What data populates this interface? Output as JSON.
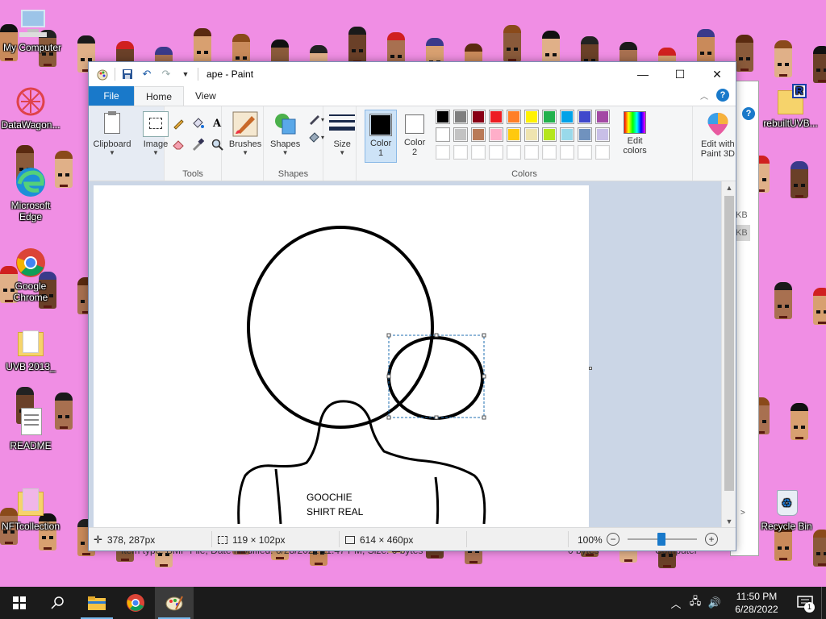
{
  "window": {
    "title": "ape - Paint",
    "minimize_glyph": "—",
    "maximize_glyph": "☐",
    "close_glyph": "✕"
  },
  "tabs": [
    {
      "label": "File"
    },
    {
      "label": "Home"
    },
    {
      "label": "View"
    }
  ],
  "help_glyph": "?",
  "ribbon": {
    "clipboard_label": "Clipboard",
    "image_label": "Image",
    "tools_group": "Tools",
    "brushes_label": "Brushes",
    "shapes_label": "Shapes",
    "shapes_group": "Shapes",
    "size_label": "Size",
    "color1_label_line1": "Color",
    "color1_label_line2": "1",
    "color2_label_line1": "Color",
    "color2_label_line2": "2",
    "edit_colors_line1": "Edit",
    "edit_colors_line2": "colors",
    "edit_paint3d_line1": "Edit with",
    "edit_paint3d_line2": "Paint 3D",
    "colors_group": "Colors",
    "text_tool_glyph": "A"
  },
  "colors": {
    "color1": "#000000",
    "color2": "#ffffff",
    "palette_row1": [
      "#000000",
      "#7f7f7f",
      "#880015",
      "#ed1c24",
      "#ff7f27",
      "#fff200",
      "#22b14c",
      "#00a2e8",
      "#3f48cc",
      "#a349a4"
    ],
    "palette_row2": [
      "#ffffff",
      "#c3c3c3",
      "#b97a57",
      "#ffaec9",
      "#ffc90e",
      "#efe4b0",
      "#b5e61d",
      "#99d9ea",
      "#7092be",
      "#c8bfe7"
    ],
    "palette_row3": [
      "#ffffff",
      "#ffffff",
      "#ffffff",
      "#ffffff",
      "#ffffff",
      "#ffffff",
      "#ffffff",
      "#ffffff",
      "#ffffff",
      "#ffffff"
    ]
  },
  "canvas": {
    "text_line1": "GOOCHIE",
    "text_line2": "SHIRT REAL"
  },
  "status": {
    "cursor_pos": "378, 287px",
    "selection_size": "119 × 102px",
    "image_size": "614 × 460px",
    "zoom": "100%",
    "zoom_minus": "−",
    "zoom_plus": "+"
  },
  "background_status": {
    "text": "Item type: BMP File, Date modified: 6/28/2022 11:47 PM, Size: 0 bytes",
    "bytes": "0 bytes",
    "computer": "Computer"
  },
  "desktop_icons": [
    {
      "label": "My Computer"
    },
    {
      "label": "DataWagon..."
    },
    {
      "label": "Microsoft Edge"
    },
    {
      "label": "Google Chrome"
    },
    {
      "label": "UVB 2013_"
    },
    {
      "label": "README"
    },
    {
      "label": "NFTcollection"
    },
    {
      "label": "rebuiltUVB..."
    },
    {
      "label": "Recycle Bin"
    }
  ],
  "explorer_side": {
    "kb1": "KB",
    "kb2": "KB"
  },
  "taskbar": {
    "time": "11:50 PM",
    "date": "6/28/2022",
    "notification_count": "1"
  }
}
